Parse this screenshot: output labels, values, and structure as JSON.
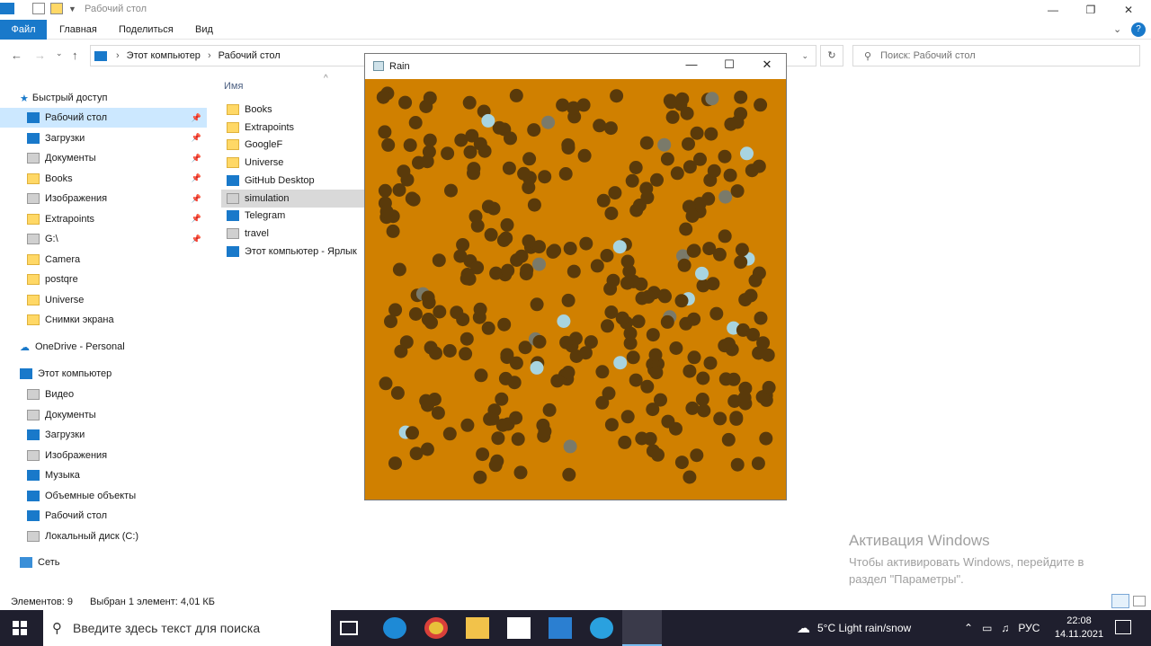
{
  "window": {
    "title": "Рабочий стол"
  },
  "ribbon": {
    "tabs": [
      "Файл",
      "Главная",
      "Поделиться",
      "Вид"
    ]
  },
  "address": {
    "crumbs": [
      "Этот компьютер",
      "Рабочий стол"
    ],
    "search_placeholder": "Поиск: Рабочий стол"
  },
  "sidebar": {
    "quick_access": "Быстрый доступ",
    "quick_items": [
      {
        "label": "Рабочий стол",
        "icon": "desktop-icon"
      },
      {
        "label": "Загрузки",
        "icon": "download-icon"
      },
      {
        "label": "Документы",
        "icon": "documents-icon"
      },
      {
        "label": "Books",
        "icon": "folder-icon"
      },
      {
        "label": "Изображения",
        "icon": "pictures-icon"
      },
      {
        "label": "Extrapoints",
        "icon": "folder-icon"
      },
      {
        "label": "G:\\",
        "icon": "drive-icon"
      },
      {
        "label": "Camera",
        "icon": "folder-icon"
      },
      {
        "label": "postqre",
        "icon": "folder-icon"
      },
      {
        "label": "Universe",
        "icon": "folder-icon"
      },
      {
        "label": "Снимки экрана",
        "icon": "folder-icon"
      }
    ],
    "onedrive": "OneDrive - Personal",
    "this_pc": "Этот компьютер",
    "pc_items": [
      {
        "label": "Видео",
        "icon": "video-icon"
      },
      {
        "label": "Документы",
        "icon": "documents-icon"
      },
      {
        "label": "Загрузки",
        "icon": "download-icon"
      },
      {
        "label": "Изображения",
        "icon": "pictures-icon"
      },
      {
        "label": "Музыка",
        "icon": "music-icon"
      },
      {
        "label": "Объемные объекты",
        "icon": "3d-objects-icon"
      },
      {
        "label": "Рабочий стол",
        "icon": "desktop-icon"
      },
      {
        "label": "Локальный диск (C:)",
        "icon": "disk-icon"
      }
    ],
    "network": "Сеть"
  },
  "files": {
    "column_name": "Имя",
    "items": [
      {
        "label": "Books",
        "icon": "folder-icon"
      },
      {
        "label": "Extrapoints",
        "icon": "folder-icon"
      },
      {
        "label": "GoogleF",
        "icon": "folder-icon"
      },
      {
        "label": "Universe",
        "icon": "folder-icon"
      },
      {
        "label": "GitHub Desktop",
        "icon": "github-icon"
      },
      {
        "label": "simulation",
        "icon": "java-icon",
        "selected": true
      },
      {
        "label": "Telegram",
        "icon": "telegram-icon"
      },
      {
        "label": "travel",
        "icon": "text-file-icon"
      },
      {
        "label": "Этот компьютер - Ярлык",
        "icon": "computer-shortcut-icon"
      }
    ]
  },
  "status": {
    "count": "Элементов: 9",
    "selection": "Выбран 1 элемент: 4,01 КБ"
  },
  "activation": {
    "title": "Активация Windows",
    "line1": "Чтобы активировать Windows, перейдите в",
    "line2": "раздел \"Параметры\"."
  },
  "rain": {
    "title": "Rain",
    "background": "#d08000",
    "drop_color": "#5a3a0a",
    "light_color": "#a8d4e0",
    "gray_color": "#7a7a6a"
  },
  "taskbar": {
    "search_text": "Введите здесь текст для поиска",
    "weather": "5°C  Light rain/snow",
    "lang": "РУС",
    "time": "22:08",
    "date": "14.11.2021"
  }
}
